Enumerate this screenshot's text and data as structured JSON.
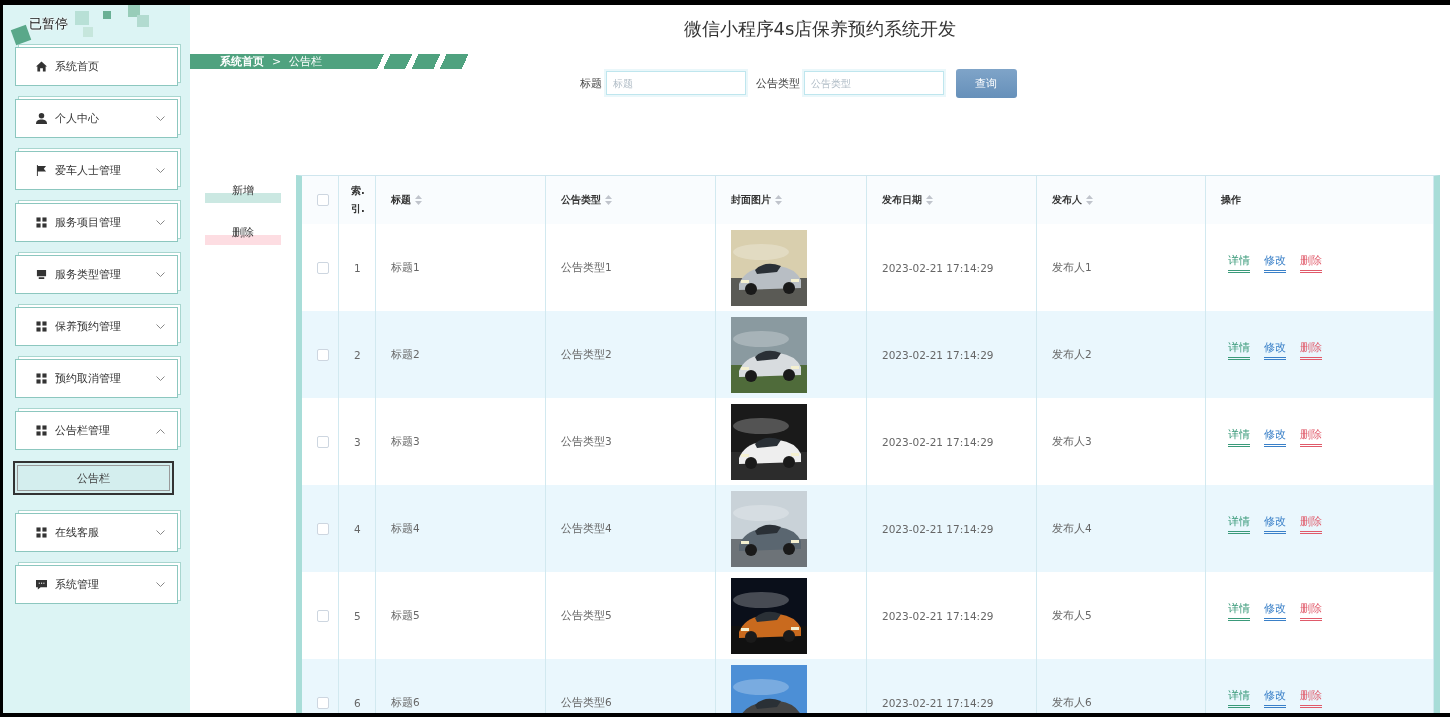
{
  "player_status": "已暂停",
  "sidebar": {
    "items": [
      {
        "label": "系统首页",
        "kind": "home"
      },
      {
        "label": "个人中心",
        "kind": "user",
        "expanded": false
      },
      {
        "label": "爱车人士管理",
        "kind": "flag",
        "expanded": false
      },
      {
        "label": "服务项目管理",
        "kind": "grid",
        "expanded": false
      },
      {
        "label": "服务类型管理",
        "kind": "device",
        "expanded": false
      },
      {
        "label": "保养预约管理",
        "kind": "grid",
        "expanded": false
      },
      {
        "label": "预约取消管理",
        "kind": "grid",
        "expanded": false
      },
      {
        "label": "公告栏管理",
        "kind": "grid",
        "expanded": true,
        "children": [
          {
            "label": "公告栏",
            "selected": true
          }
        ]
      },
      {
        "label": "在线客服",
        "kind": "grid",
        "expanded": false
      },
      {
        "label": "系统管理",
        "kind": "chat",
        "expanded": false
      }
    ]
  },
  "page_title": "微信小程序4s店保养预约系统开发",
  "breadcrumb": [
    "系统首页",
    "公告栏"
  ],
  "breadcrumb_separator": ">",
  "search": {
    "fields": [
      {
        "label": "标题",
        "placeholder": "标题"
      },
      {
        "label": "公告类型",
        "placeholder": "公告类型"
      }
    ],
    "button": "查询"
  },
  "side_buttons": [
    {
      "label": "新增",
      "kind": "add"
    },
    {
      "label": "删除",
      "kind": "delete"
    }
  ],
  "table": {
    "all_checked": false,
    "columns": [
      {
        "label": "索.引.",
        "sortable": false
      },
      {
        "label": "标题",
        "sortable": true
      },
      {
        "label": "公告类型",
        "sortable": true
      },
      {
        "label": "封面图片",
        "sortable": true
      },
      {
        "label": "发布日期",
        "sortable": true
      },
      {
        "label": "发布人",
        "sortable": true
      },
      {
        "label": "操作",
        "sortable": false
      }
    ],
    "rows": [
      {
        "checked": false,
        "index": "1",
        "title": "标题1",
        "type": "公告类型1",
        "date": "2023-02-21 17:14:29",
        "publisher": "发布人1",
        "actions": [
          {
            "label": "详情",
            "color": "#3a9a7a"
          },
          {
            "label": "修改",
            "color": "#3a80c8"
          },
          {
            "label": "删除",
            "color": "#e05a6a"
          }
        ]
      },
      {
        "checked": false,
        "index": "2",
        "title": "标题2",
        "type": "公告类型2",
        "date": "2023-02-21 17:14:29",
        "publisher": "发布人2",
        "actions": [
          {
            "label": "详情",
            "color": "#3a9a7a"
          },
          {
            "label": "修改",
            "color": "#3a80c8"
          },
          {
            "label": "删除",
            "color": "#e05a6a"
          }
        ]
      },
      {
        "checked": false,
        "index": "3",
        "title": "标题3",
        "type": "公告类型3",
        "date": "2023-02-21 17:14:29",
        "publisher": "发布人3",
        "actions": [
          {
            "label": "详情",
            "color": "#3a9a7a"
          },
          {
            "label": "修改",
            "color": "#3a80c8"
          },
          {
            "label": "删除",
            "color": "#e05a6a"
          }
        ]
      },
      {
        "checked": false,
        "index": "4",
        "title": "标题4",
        "type": "公告类型4",
        "date": "2023-02-21 17:14:29",
        "publisher": "发布人4",
        "actions": [
          {
            "label": "详情",
            "color": "#3a9a7a"
          },
          {
            "label": "修改",
            "color": "#3a80c8"
          },
          {
            "label": "删除",
            "color": "#e05a6a"
          }
        ]
      },
      {
        "checked": false,
        "index": "5",
        "title": "标题5",
        "type": "公告类型5",
        "date": "2023-02-21 17:14:29",
        "publisher": "发布人5",
        "actions": [
          {
            "label": "详情",
            "color": "#3a9a7a"
          },
          {
            "label": "修改",
            "color": "#3a80c8"
          },
          {
            "label": "删除",
            "color": "#e05a6a"
          }
        ]
      },
      {
        "checked": false,
        "index": "6",
        "title": "标题6",
        "type": "公告类型6",
        "date": "2023-02-21 17:14:29",
        "publisher": "发布人6",
        "actions": [
          {
            "label": "详情",
            "color": "#3a9a7a"
          },
          {
            "label": "修改",
            "color": "#3a80c8"
          },
          {
            "label": "删除",
            "color": "#e05a6a"
          }
        ]
      }
    ]
  }
}
